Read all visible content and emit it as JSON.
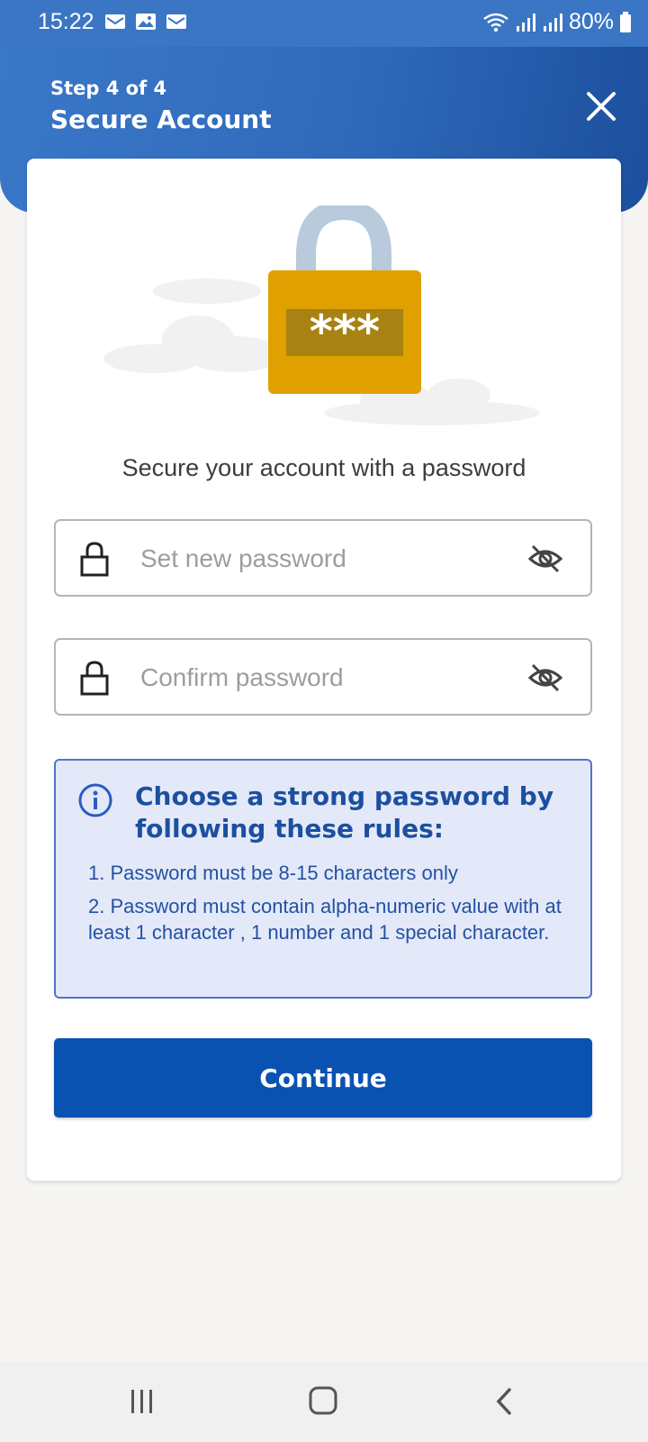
{
  "status_bar": {
    "time": "15:22",
    "battery": "80%",
    "icons": [
      "message-icon",
      "image-icon",
      "message-icon",
      "wifi-icon",
      "signal-icon",
      "signal-icon",
      "battery-icon"
    ]
  },
  "header": {
    "step": "Step 4 of 4",
    "title": "Secure Account",
    "close_icon": "close-icon"
  },
  "main": {
    "subtitle": "Secure your account with a password",
    "new_password": {
      "placeholder": "Set new password",
      "value": ""
    },
    "confirm_password": {
      "placeholder": "Confirm password",
      "value": ""
    },
    "rules": {
      "title": "Choose a strong password by following these rules:",
      "items": [
        "1. Password must be 8-15 characters only",
        "2.  Password must contain alpha-numeric value with at least 1 character , 1 number and 1 special character."
      ]
    },
    "continue_label": "Continue",
    "illustration_text": "***"
  },
  "nav": {
    "icons": [
      "recent-apps-icon",
      "home-icon",
      "back-icon"
    ]
  },
  "colors": {
    "header_blue": "#3a76c4",
    "button_blue": "#0a52b2",
    "rules_bg": "#e3e9f8",
    "lock_gold": "#e0a000"
  }
}
